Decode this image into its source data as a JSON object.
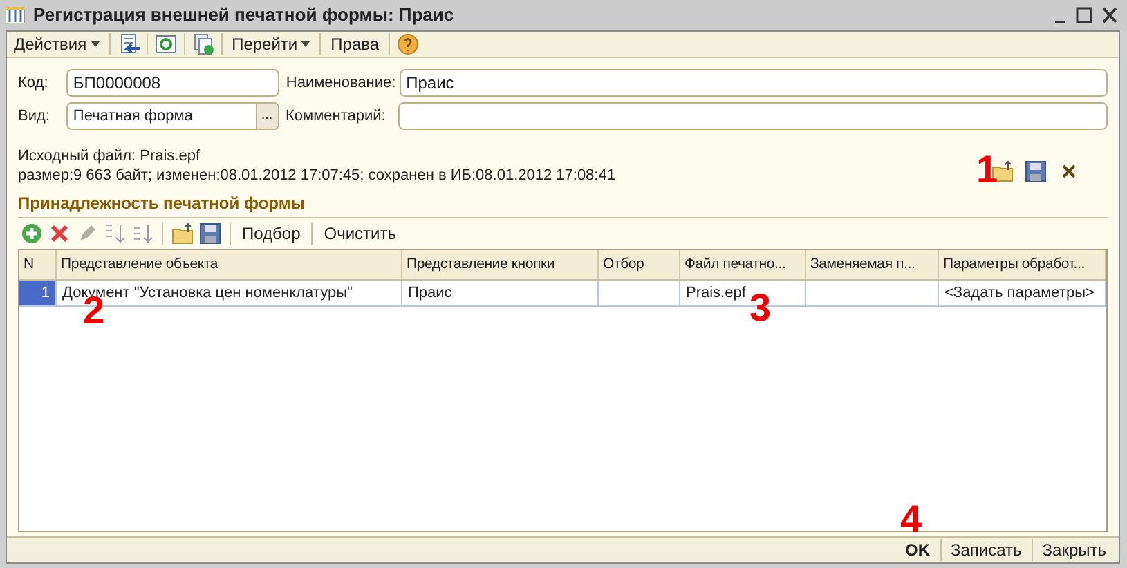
{
  "window": {
    "title": "Регистрация внешней печатной формы: Праис"
  },
  "toolbar": [
    {
      "kind": "menu",
      "label": "Действия"
    },
    {
      "kind": "icon"
    },
    {
      "kind": "icon"
    },
    {
      "kind": "icon"
    },
    {
      "kind": "menu",
      "label": "Перейти"
    },
    {
      "kind": "text",
      "label": "Права"
    },
    {
      "kind": "icon"
    }
  ],
  "fields": {
    "code": {
      "label": "Код:",
      "value": "БП0000008"
    },
    "name": {
      "label": "Наименование:",
      "value": "Праис"
    },
    "type": {
      "label": "Вид:",
      "value": "Печатная форма",
      "choice": "..."
    },
    "comment": {
      "label": "Комментарий:"
    }
  },
  "file_info": [
    "Исходный файл: Prais.epf",
    "размер:9 663 байт; изменен:08.01.2012 17:07:45; сохранен в ИБ:08.01.2012 17:08:41"
  ],
  "section": {
    "title": "Принадлежность печатной формы"
  },
  "table_toolbar": [
    {
      "kind": "icon"
    },
    {
      "kind": "icon"
    },
    {
      "kind": "icon"
    },
    {
      "kind": "icon"
    },
    {
      "kind": "icon"
    },
    {
      "kind": "icon"
    },
    {
      "kind": "icon"
    },
    {
      "kind": "text",
      "label": "Подбор"
    },
    {
      "kind": "text",
      "label": "Очистить"
    }
  ],
  "table": {
    "columns": [
      "N",
      "Представление объекта",
      "Представление кнопки",
      "Отбор",
      "Файл печатно...",
      "Заменяемая п...",
      "Параметры обработ..."
    ],
    "rows": [
      {
        "selected": true,
        "cells": [
          "1",
          "Документ \"Установка цен номенклатуры\"",
          "Праис",
          "",
          "Prais.epf",
          "",
          "<Задать параметры>"
        ]
      }
    ]
  },
  "buttons": [
    {
      "label": "OK",
      "default": true
    },
    {
      "label": "Записать",
      "default": false
    },
    {
      "label": "Закрыть",
      "default": false
    }
  ],
  "annotations": [
    "1",
    "2",
    "3",
    "4"
  ]
}
